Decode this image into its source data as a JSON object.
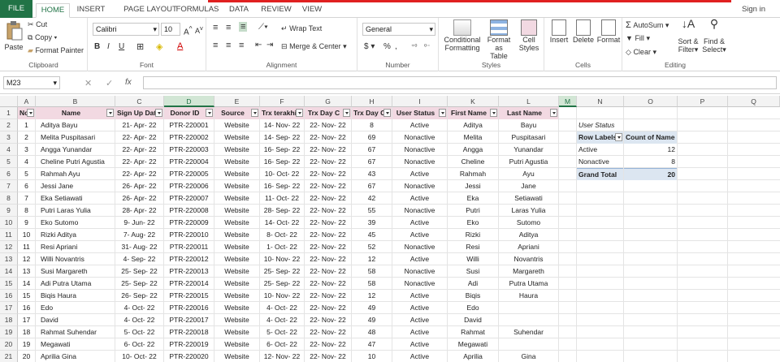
{
  "tabs": [
    "FILE",
    "HOME",
    "INSERT",
    "PAGE LAYOUT",
    "FORMULAS",
    "DATA",
    "REVIEW",
    "VIEW"
  ],
  "signin": "Sign in",
  "ribbon": {
    "paste": "Paste",
    "cut": "Cut",
    "copy": "Copy",
    "format_painter": "Format Painter",
    "clipboard": "Clipboard",
    "font_name": "Calibri",
    "font_size": "10",
    "font": "Font",
    "wrap_text": "Wrap Text",
    "merge_center": "Merge & Center",
    "alignment": "Alignment",
    "number_format": "General",
    "number": "Number",
    "conditional": "Conditional",
    "formatting": "Formatting",
    "format_as": "Format as",
    "table": "Table",
    "cell": "Cell",
    "styles_btn": "Styles",
    "styles": "Styles",
    "insert": "Insert",
    "delete": "Delete",
    "format": "Format",
    "cells": "Cells",
    "autosum": "AutoSum",
    "fill": "Fill",
    "clear": "Clear",
    "sort": "Sort &",
    "filter": "Filter",
    "find": "Find &",
    "select": "Select",
    "editing": "Editing"
  },
  "namebox": "M23",
  "fx": "fx",
  "columns": [
    "A",
    "B",
    "C",
    "D",
    "E",
    "F",
    "G",
    "H",
    "I",
    "K",
    "L",
    "M",
    "N",
    "O",
    "P",
    "Q"
  ],
  "headers": [
    "No",
    "Name",
    "Sign Up Dat",
    "Donor ID",
    "Source",
    "Trx terakhi",
    "Trx Day C",
    "Trx Day C",
    "User Status",
    "First Name",
    "Last Name"
  ],
  "rows": [
    [
      "1",
      "Aditya Bayu",
      "21- Apr- 22",
      "PTR-220001",
      "Website",
      "14- Nov- 22",
      "22- Nov- 22",
      "8",
      "Active",
      "Aditya",
      "Bayu"
    ],
    [
      "2",
      "Melita Puspitasari",
      "22- Apr- 22",
      "PTR-220002",
      "Website",
      "14- Sep- 22",
      "22- Nov- 22",
      "69",
      "Nonactive",
      "Melita",
      "Puspitasari"
    ],
    [
      "3",
      "Angga Yunandar",
      "22- Apr- 22",
      "PTR-220003",
      "Website",
      "16- Sep- 22",
      "22- Nov- 22",
      "67",
      "Nonactive",
      "Angga",
      "Yunandar"
    ],
    [
      "4",
      "Cheline Putri Agustia",
      "22- Apr- 22",
      "PTR-220004",
      "Website",
      "16- Sep- 22",
      "22- Nov- 22",
      "67",
      "Nonactive",
      "Cheline",
      "Putri Agustia"
    ],
    [
      "5",
      "Rahmah Ayu",
      "22- Apr- 22",
      "PTR-220005",
      "Website",
      "10- Oct- 22",
      "22- Nov- 22",
      "43",
      "Active",
      "Rahmah",
      "Ayu"
    ],
    [
      "6",
      "Jessi Jane",
      "26- Apr- 22",
      "PTR-220006",
      "Website",
      "16- Sep- 22",
      "22- Nov- 22",
      "67",
      "Nonactive",
      "Jessi",
      "Jane"
    ],
    [
      "7",
      "Eka Setiawati",
      "26- Apr- 22",
      "PTR-220007",
      "Website",
      "11- Oct- 22",
      "22- Nov- 22",
      "42",
      "Active",
      "Eka",
      "Setiawati"
    ],
    [
      "8",
      "Putri Laras Yulia",
      "28- Apr- 22",
      "PTR-220008",
      "Website",
      "28- Sep- 22",
      "22- Nov- 22",
      "55",
      "Nonactive",
      "Putri",
      "Laras Yulia"
    ],
    [
      "9",
      "Eko Sutomo",
      "9- Jun- 22",
      "PTR-220009",
      "Website",
      "14- Oct- 22",
      "22- Nov- 22",
      "39",
      "Active",
      "Eko",
      "Sutomo"
    ],
    [
      "10",
      "Rizki Aditya",
      "7- Aug- 22",
      "PTR-220010",
      "Website",
      "8- Oct- 22",
      "22- Nov- 22",
      "45",
      "Active",
      "Rizki",
      "Aditya"
    ],
    [
      "11",
      "Resi Apriani",
      "31- Aug- 22",
      "PTR-220011",
      "Website",
      "1- Oct- 22",
      "22- Nov- 22",
      "52",
      "Nonactive",
      "Resi",
      "Apriani"
    ],
    [
      "12",
      "Willi Novantris",
      "4- Sep- 22",
      "PTR-220012",
      "Website",
      "10- Nov- 22",
      "22- Nov- 22",
      "12",
      "Active",
      "Willi",
      "Novantris"
    ],
    [
      "13",
      "Susi Margareth",
      "25- Sep- 22",
      "PTR-220013",
      "Website",
      "25- Sep- 22",
      "22- Nov- 22",
      "58",
      "Nonactive",
      "Susi",
      "Margareth"
    ],
    [
      "14",
      "Adi Putra Utama",
      "25- Sep- 22",
      "PTR-220014",
      "Website",
      "25- Sep- 22",
      "22- Nov- 22",
      "58",
      "Nonactive",
      "Adi",
      "Putra Utama"
    ],
    [
      "15",
      "Biqis Haura",
      "26- Sep- 22",
      "PTR-220015",
      "Website",
      "10- Nov- 22",
      "22- Nov- 22",
      "12",
      "Active",
      "Biqis",
      "Haura"
    ],
    [
      "16",
      "Edo",
      "4- Oct- 22",
      "PTR-220016",
      "Website",
      "4- Oct- 22",
      "22- Nov- 22",
      "49",
      "Active",
      "Edo",
      ""
    ],
    [
      "17",
      "David",
      "4- Oct- 22",
      "PTR-220017",
      "Website",
      "4- Oct- 22",
      "22- Nov- 22",
      "49",
      "Active",
      "David",
      ""
    ],
    [
      "18",
      "Rahmat Suhendar",
      "5- Oct- 22",
      "PTR-220018",
      "Website",
      "5- Oct- 22",
      "22- Nov- 22",
      "48",
      "Active",
      "Rahmat",
      "Suhendar"
    ],
    [
      "19",
      "Megawati",
      "6- Oct- 22",
      "PTR-220019",
      "Website",
      "6- Oct- 22",
      "22- Nov- 22",
      "47",
      "Active",
      "Megawati",
      ""
    ],
    [
      "20",
      "Aprilia Gina",
      "10- Oct- 22",
      "PTR-220020",
      "Website",
      "12- Nov- 22",
      "22- Nov- 22",
      "10",
      "Active",
      "Aprilia",
      "Gina"
    ]
  ],
  "pivot": {
    "filter_label": "User Status",
    "row_labels": "Row Labels",
    "count_label": "Count of Name",
    "rows": [
      [
        "Active",
        "12"
      ],
      [
        "Nonactive",
        "8"
      ]
    ],
    "total_label": "Grand Total",
    "total": "20"
  },
  "colors": {
    "accent": "#217346",
    "header_fill": "#f2d9e2",
    "pivot_fill": "#dce6f1"
  }
}
